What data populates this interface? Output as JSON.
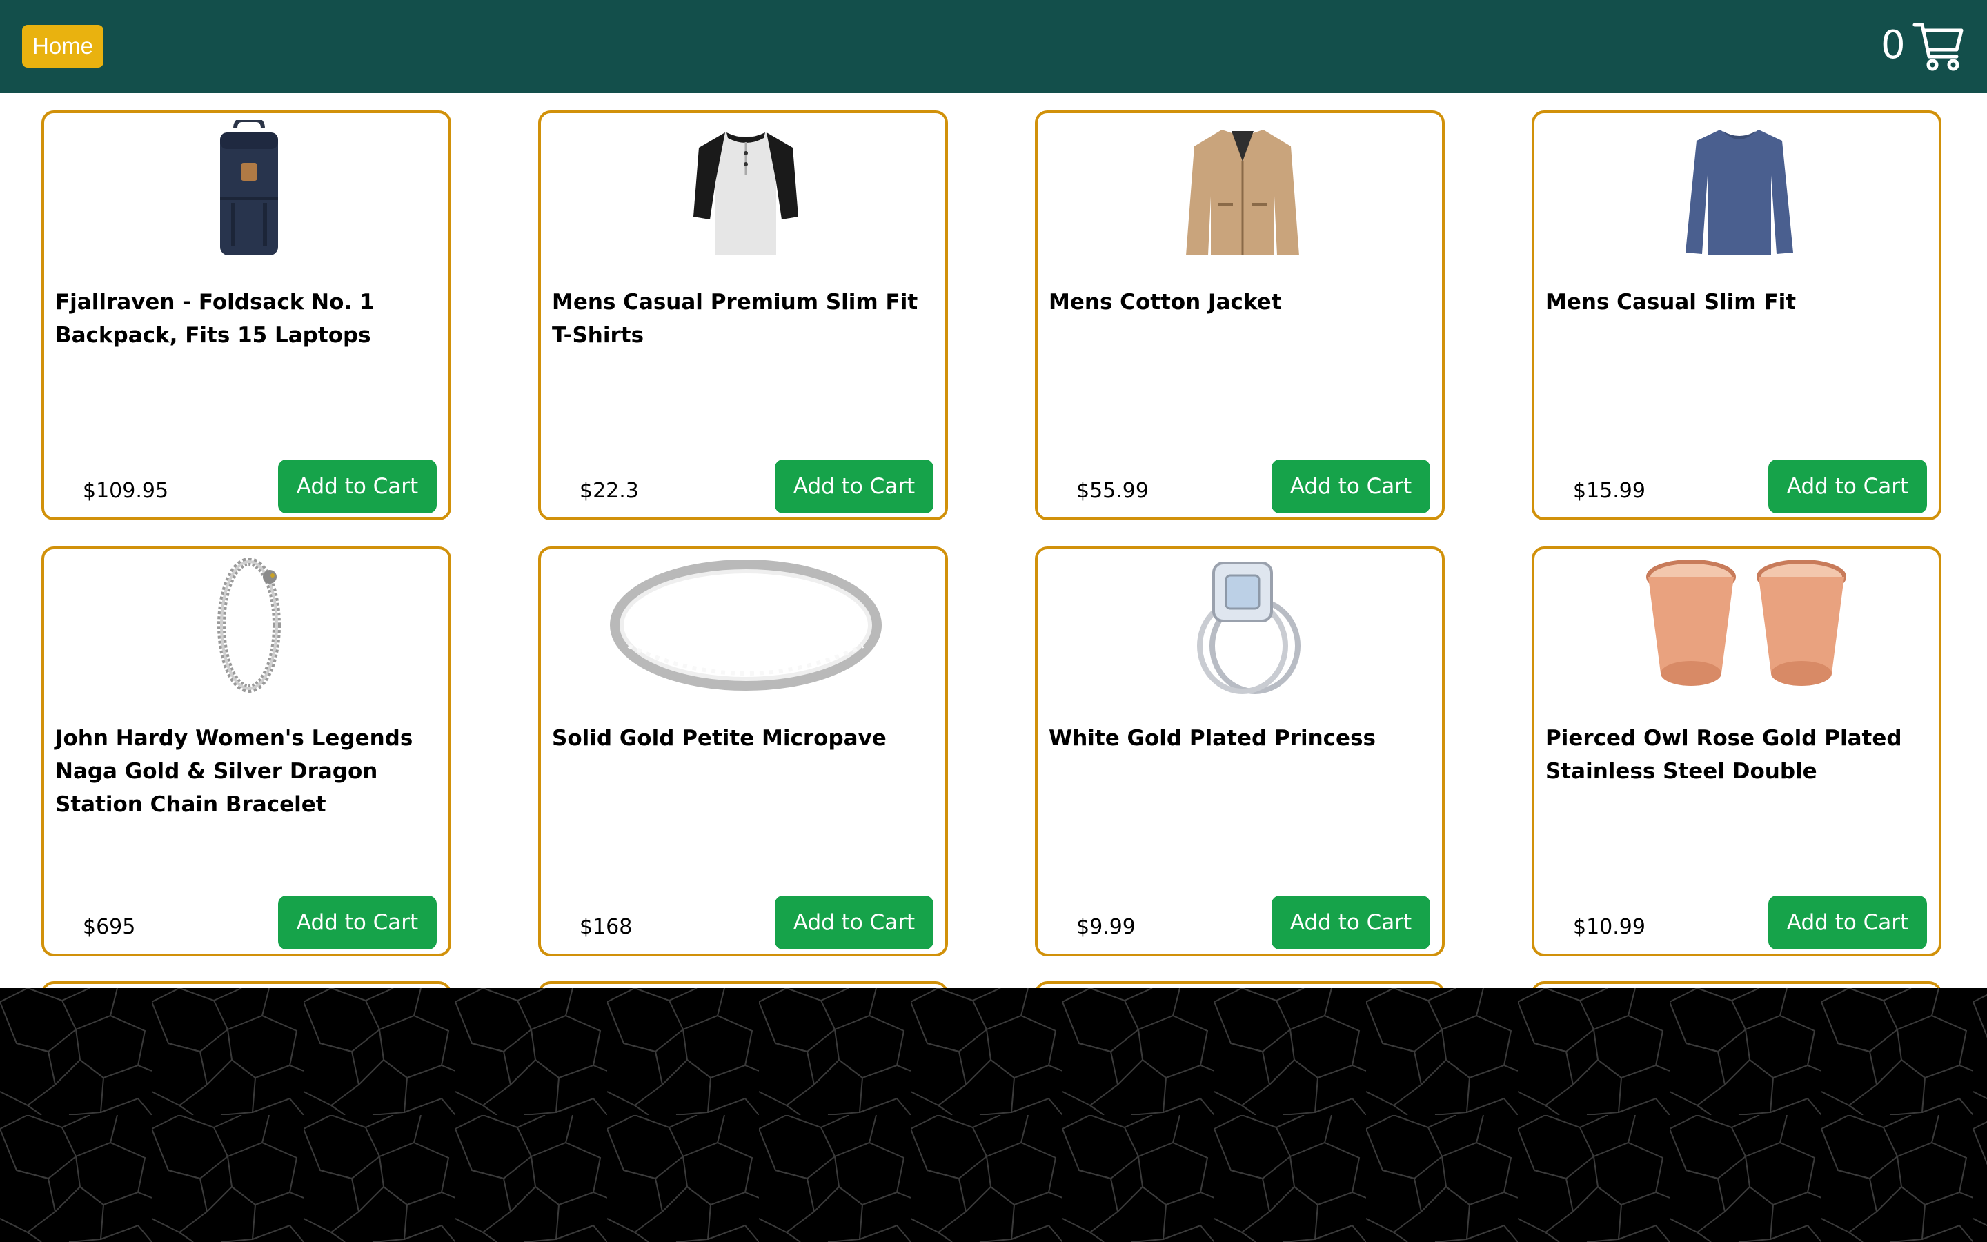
{
  "header": {
    "home_label": "Home",
    "cart_count": "0",
    "cart_icon": "shopping-cart-icon"
  },
  "colors": {
    "header_bg": "#134f4b",
    "home_button": "#e9b20f",
    "card_border": "#d1910a",
    "add_button": "#16a34a",
    "footer_bg": "#000000"
  },
  "products": [
    {
      "title": "Fjallraven - Foldsack No. 1 Backpack, Fits 15 Laptops",
      "price": "$109.95",
      "button": "Add to Cart",
      "image": "backpack"
    },
    {
      "title": "Mens Casual Premium Slim Fit T-Shirts",
      "price": "$22.3",
      "button": "Add to Cart",
      "image": "raglan-tshirt"
    },
    {
      "title": "Mens Cotton Jacket",
      "price": "$55.99",
      "button": "Add to Cart",
      "image": "jacket"
    },
    {
      "title": "Mens Casual Slim Fit",
      "price": "$15.99",
      "button": "Add to Cart",
      "image": "long-sleeve-shirt"
    },
    {
      "title": "John Hardy Women's Legends Naga Gold & Silver Dragon Station Chain Bracelet",
      "price": "$695",
      "button": "Add to Cart",
      "image": "chain-bracelet"
    },
    {
      "title": "Solid Gold Petite Micropave",
      "price": "$168",
      "button": "Add to Cart",
      "image": "micropave-ring"
    },
    {
      "title": "White Gold Plated Princess",
      "price": "$9.99",
      "button": "Add to Cart",
      "image": "princess-ring"
    },
    {
      "title": "Pierced Owl Rose Gold Plated Stainless Steel Double",
      "price": "$10.99",
      "button": "Add to Cart",
      "image": "rose-gold-tunnels"
    }
  ]
}
